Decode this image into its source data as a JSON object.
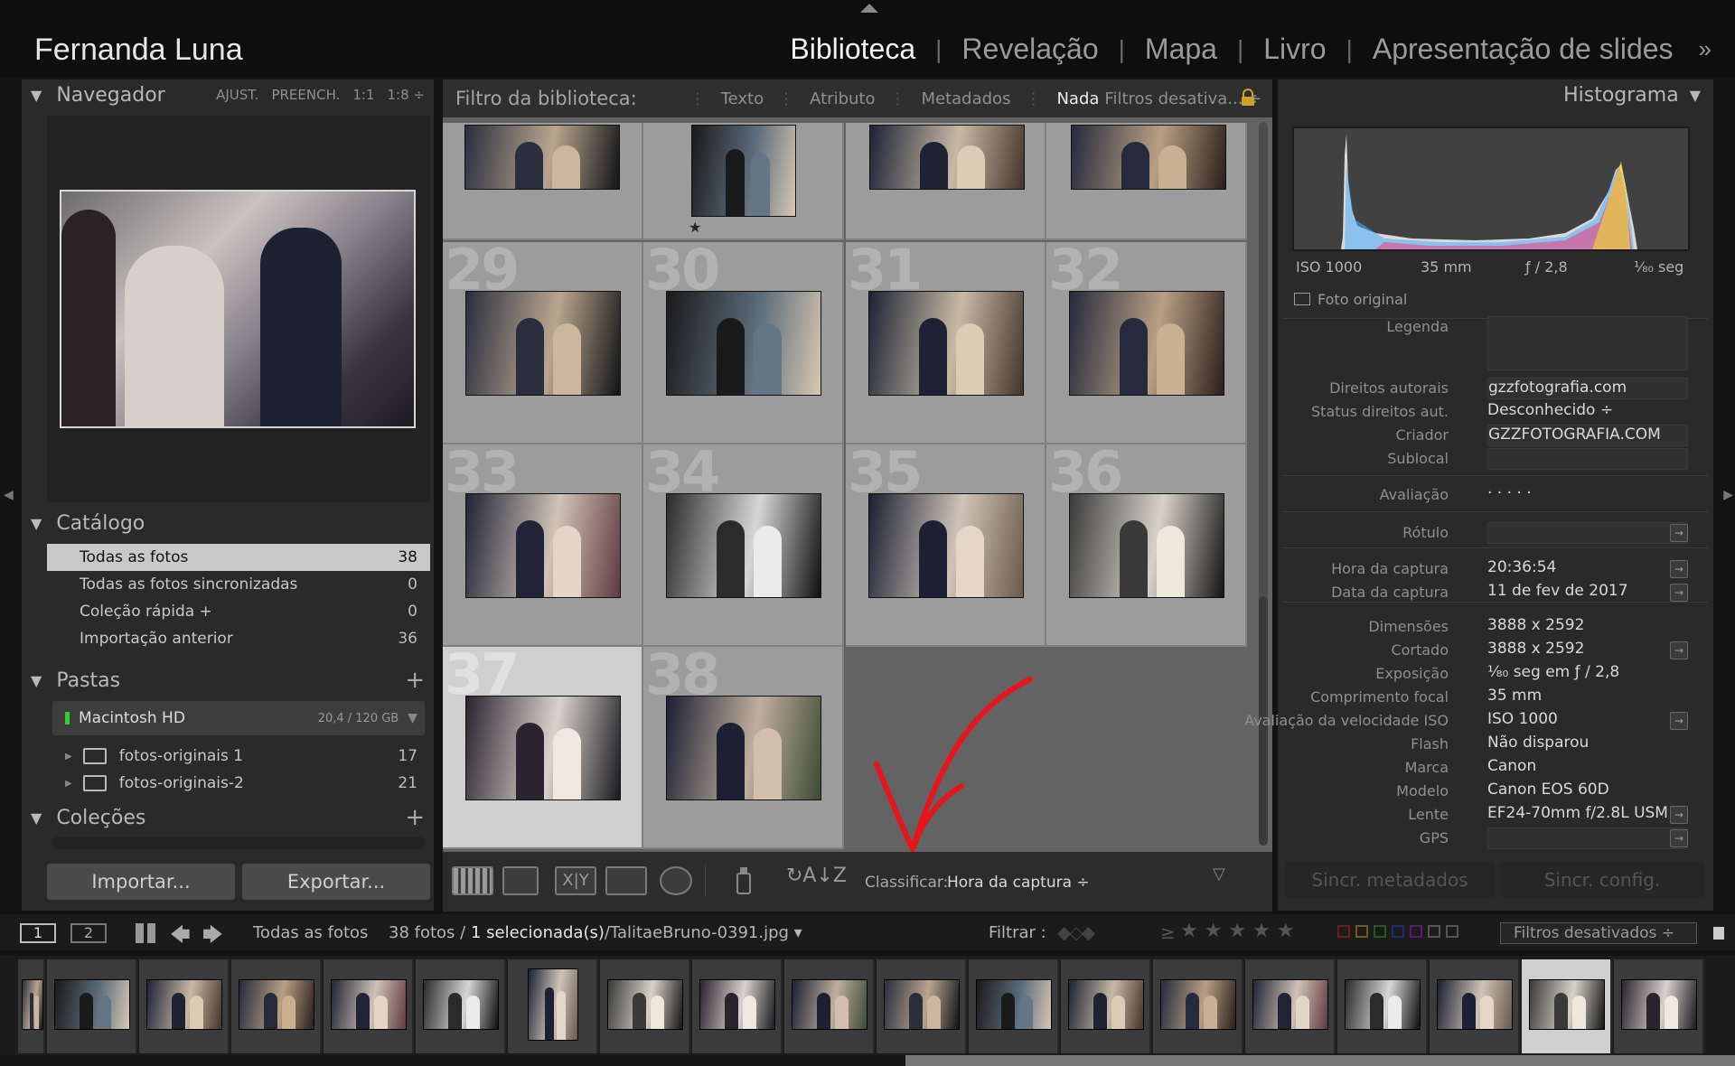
{
  "identity_plate": "Fernanda Luna",
  "modules": [
    "Biblioteca",
    "Revelação",
    "Mapa",
    "Livro",
    "Apresentação de slides"
  ],
  "modules_more": "»",
  "navigator": {
    "title": "Navegador",
    "options": [
      "AJUST.",
      "PREENCH.",
      "1:1",
      "1:8 ÷"
    ]
  },
  "catalog": {
    "title": "Catálogo",
    "items": [
      {
        "label": "Todas as fotos",
        "count": "38"
      },
      {
        "label": "Todas as fotos sincronizadas",
        "count": "0"
      },
      {
        "label": "Coleção rápida  +",
        "count": "0"
      },
      {
        "label": "Importação anterior",
        "count": "36"
      }
    ]
  },
  "folders": {
    "title": "Pastas",
    "plus": "+",
    "volume": {
      "name": "Macintosh HD",
      "size": "20,4 / 120 GB"
    },
    "items": [
      {
        "label": "fotos-originais 1",
        "count": "17"
      },
      {
        "label": "fotos-originais-2",
        "count": "21"
      }
    ]
  },
  "collections": {
    "title": "Coleções",
    "plus": "+"
  },
  "buttons": {
    "import": "Importar...",
    "export": "Exportar..."
  },
  "filter_bar": {
    "label": "Filtro da biblioteca:",
    "tabs": [
      "Texto",
      "Atributo",
      "Metadados",
      "Nada"
    ],
    "preset": "Filtros desativa... ÷"
  },
  "grid": {
    "row_numbers": [
      "29",
      "30",
      "31",
      "32",
      "33",
      "34",
      "35",
      "36",
      "37",
      "38"
    ]
  },
  "grid_star": "★",
  "toolbar": {
    "sort_label": "Classificar:",
    "sort_value": "Hora da captura ÷"
  },
  "right": {
    "histogram_title": "Histograma",
    "hist_info": {
      "iso": "ISO 1000",
      "focal": "35 mm",
      "aperture": "ƒ / 2,8",
      "shutter": "¹⁄₈₀ seg"
    },
    "original_photo": "Foto original",
    "metadata": [
      {
        "label": "Legenda",
        "value": ""
      },
      {
        "label": "Direitos autorais",
        "value": "gzzfotografia.com"
      },
      {
        "label": "Status direitos aut.",
        "value": "Desconhecido ÷"
      },
      {
        "label": "Criador",
        "value": "GZZFOTOGRAFIA.COM"
      },
      {
        "label": "Sublocal",
        "value": ""
      },
      {
        "label": "Avaliação",
        "value": "·  ·  ·  ·  ·"
      },
      {
        "label": "Rótulo",
        "value": ""
      },
      {
        "label": "Hora da captura",
        "value": "20:36:54"
      },
      {
        "label": "Data da captura",
        "value": "11 de fev de 2017"
      },
      {
        "label": "Dimensões",
        "value": "3888 x 2592"
      },
      {
        "label": "Cortado",
        "value": "3888 x 2592"
      },
      {
        "label": "Exposição",
        "value": "¹⁄₈₀ seg em ƒ / 2,8"
      },
      {
        "label": "Comprimento focal",
        "value": "35 mm"
      },
      {
        "label": "Avaliação da velocidade ISO",
        "value": "ISO 1000"
      },
      {
        "label": "Flash",
        "value": "Não disparou"
      },
      {
        "label": "Marca",
        "value": "Canon"
      },
      {
        "label": "Modelo",
        "value": "Canon EOS 60D"
      },
      {
        "label": "Lente",
        "value": "EF24-70mm f/2.8L USM"
      },
      {
        "label": "GPS",
        "value": ""
      }
    ],
    "sync_metadata": "Sincr. metadados",
    "sync_settings": "Sincr. config."
  },
  "filmstrip_bar": {
    "page1": "1",
    "page2": "2",
    "source": "Todas as fotos",
    "count": "38 fotos /",
    "selected": "1 selecionada(s)",
    "filename": "/TalitaeBruno-0391.jpg ▾",
    "filter_label": "Filtrar :",
    "ge": "≥",
    "stars": "★ ★ ★ ★ ★",
    "preset": "Filtros desativados ÷"
  },
  "colors": {
    "accent_red": "#e8141c",
    "selected_cell": "#cfcfcf",
    "panel_bg": "#2a2a2a"
  }
}
